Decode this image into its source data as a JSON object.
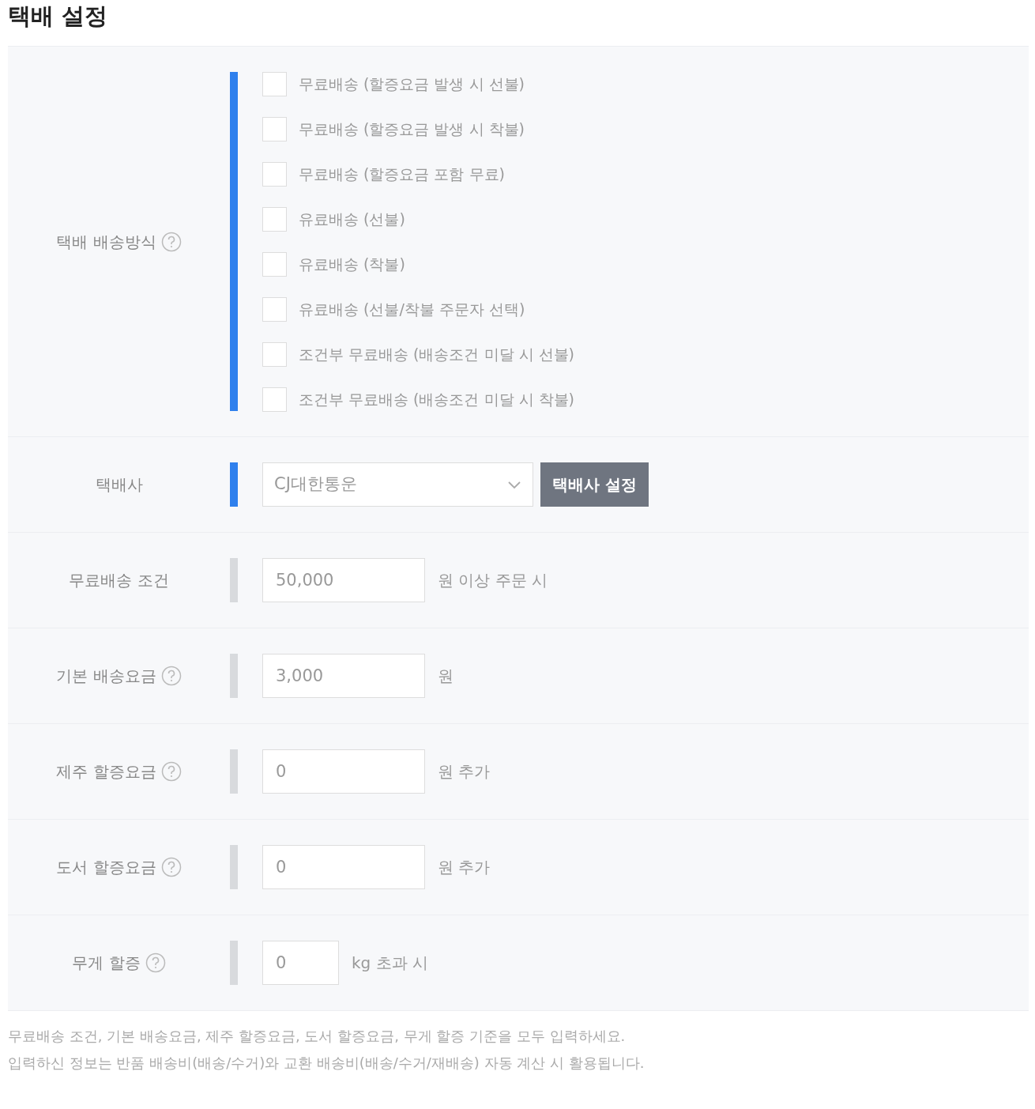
{
  "title": "택배 설정",
  "rows": [
    {
      "kind": "checkboxes",
      "label": "택배 배송방식",
      "help": true,
      "highlighted": true,
      "options": [
        {
          "label": "무료배송 (할증요금 발생 시 선불)",
          "checked": false
        },
        {
          "label": "무료배송 (할증요금 발생 시 착불)",
          "checked": false
        },
        {
          "label": "무료배송 (할증요금 포함 무료)",
          "checked": false
        },
        {
          "label": "유료배송 (선불)",
          "checked": false
        },
        {
          "label": "유료배송 (착불)",
          "checked": false
        },
        {
          "label": "유료배송 (선불/착불 주문자 선택)",
          "checked": false
        },
        {
          "label": "조건부 무료배송 (배송조건 미달 시 선불)",
          "checked": false
        },
        {
          "label": "조건부 무료배송 (배송조건 미달 시 착불)",
          "checked": false
        }
      ]
    },
    {
      "kind": "select",
      "label": "택배사",
      "help": false,
      "highlighted": true,
      "value": "CJ대한통운",
      "button": "택배사 설정"
    },
    {
      "kind": "input",
      "label": "무료배송 조건",
      "help": false,
      "highlighted": false,
      "value": "50,000",
      "suffix": "원 이상 주문 시"
    },
    {
      "kind": "input",
      "label": "기본 배송요금",
      "help": true,
      "highlighted": false,
      "value": "3,000",
      "suffix": "원"
    },
    {
      "kind": "input",
      "label": "제주 할증요금",
      "help": true,
      "highlighted": false,
      "value": "0",
      "suffix": "원 추가"
    },
    {
      "kind": "input",
      "label": "도서 할증요금",
      "help": true,
      "highlighted": false,
      "value": "0",
      "suffix": "원 추가"
    },
    {
      "kind": "input_short",
      "label": "무게 할증",
      "help": true,
      "highlighted": false,
      "value": "0",
      "suffix": "kg 초과 시"
    }
  ],
  "notes": [
    "무료배송 조건, 기본 배송요금, 제주 할증요금, 도서 할증요금, 무게 할증 기준을 모두 입력하세요.",
    "입력하신 정보는 반품 배송비(배송/수거)와 교환 배송비(배송/수거/재배송) 자동 계산 시 활용됩니다."
  ]
}
